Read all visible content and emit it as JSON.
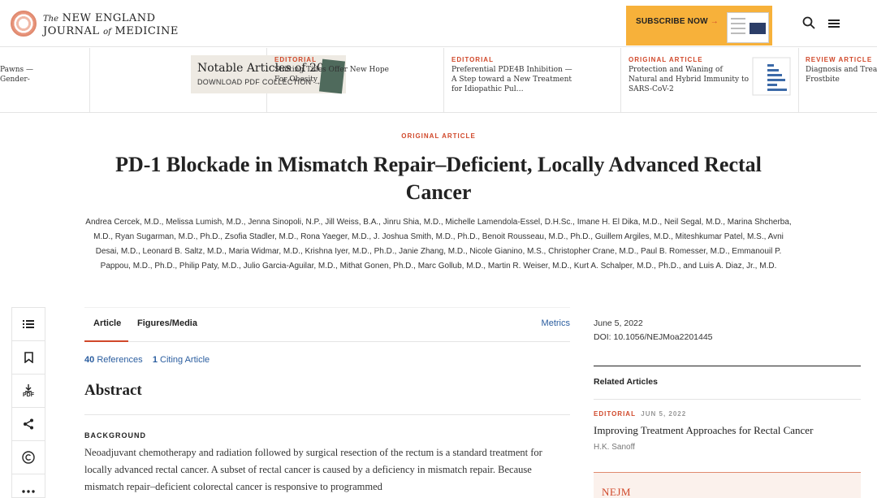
{
  "header": {
    "logo_line1_prefix": "The",
    "logo_line1": "NEW ENGLAND",
    "logo_line2_a": "JOURNAL",
    "logo_line2_of": "of",
    "logo_line2_b": "MEDICINE",
    "subscribe_label": "SUBSCRIBE NOW",
    "subscribe_arrow": "→",
    "search_icon": "search-icon",
    "menu_icon": "menu-icon"
  },
  "strip": {
    "partial_left_lines": [
      "Pawns —",
      "Gender-"
    ],
    "notable_title": "Notable Articles of 2021",
    "notable_sub": "DOWNLOAD PDF COLLECTION →",
    "items": [
      {
        "tag": "EDITORIAL",
        "title": "Shifting Tides Offer New Hope For Obesity"
      },
      {
        "tag": "EDITORIAL",
        "title": "Preferential PDE4B Inhibition — A Step toward a New Treatment for Idiopathic Pul…"
      },
      {
        "tag": "ORIGINAL ARTICLE",
        "title": "Protection and Waning of Natural and Hybrid Immunity to SARS-CoV-2"
      },
      {
        "tag": "REVIEW ARTICLE",
        "title": "Diagnosis and Treatm… Frostbite"
      }
    ]
  },
  "article": {
    "type": "ORIGINAL ARTICLE",
    "title": "PD-1 Blockade in Mismatch Repair–Deficient, Locally Advanced Rectal Cancer",
    "authors": "Andrea Cercek, M.D., Melissa Lumish, M.D., Jenna Sinopoli, N.P., Jill Weiss, B.A., Jinru Shia, M.D., Michelle Lamendola-Essel, D.H.Sc., Imane H. El Dika, M.D., Neil Segal, M.D., Marina Shcherba, M.D., Ryan Sugarman, M.D., Ph.D., Zsofia Stadler, M.D., Rona Yaeger, M.D., J. Joshua Smith, M.D., Ph.D., Benoit Rousseau, M.D., Ph.D., Guillem Argiles, M.D., Miteshkumar Patel, M.S., Avni Desai, M.D., Leonard B. Saltz, M.D., Maria Widmar, M.D., Krishna Iyer, M.D., Ph.D., Janie Zhang, M.D., Nicole Gianino, M.S., Christopher Crane, M.D., Paul B. Romesser, M.D., Emmanouil P. Pappou, M.D., Ph.D., Philip Paty, M.D., Julio Garcia-Aguilar, M.D., Mithat Gonen, Ph.D., Marc Gollub, M.D., Martin R. Weiser, M.D., Kurt A. Schalper, M.D., Ph.D., and Luis A. Diaz, Jr., M.D."
  },
  "rail": {
    "items": [
      "list-icon",
      "bookmark-icon",
      "pdf-download-icon",
      "share-icon",
      "copyright-icon",
      "more-icon"
    ],
    "pdf_label": "PDF"
  },
  "tabs": {
    "article": "Article",
    "figures": "Figures/Media",
    "metrics": "Metrics"
  },
  "refs": {
    "ref_count": "40",
    "ref_label": "References",
    "cite_count": "1",
    "cite_label": "Citing Article"
  },
  "abstract": {
    "heading": "Abstract",
    "background_label": "BACKGROUND",
    "background_text": "Neoadjuvant chemotherapy and radiation followed by surgical resection of the rectum is a standard treatment for locally advanced rectal cancer. A subset of rectal cancer is caused by a deficiency in mismatch repair. Because mismatch repair–deficient colorectal cancer is responsive to programmed"
  },
  "sidebar": {
    "date": "June 5, 2022",
    "doi": "DOI: 10.1056/NEJMoa2201445",
    "related_label": "Related Articles",
    "related": {
      "tag": "EDITORIAL",
      "date": "JUN 5, 2022",
      "title": "Improving Treatment Approaches for Rectal Cancer",
      "author": "H.K. Sanoff"
    },
    "promo_logo": "NEJM"
  },
  "colors": {
    "accent": "#d0482a",
    "link": "#2a5d9f",
    "subscribe_bg": "#f7b13a"
  }
}
